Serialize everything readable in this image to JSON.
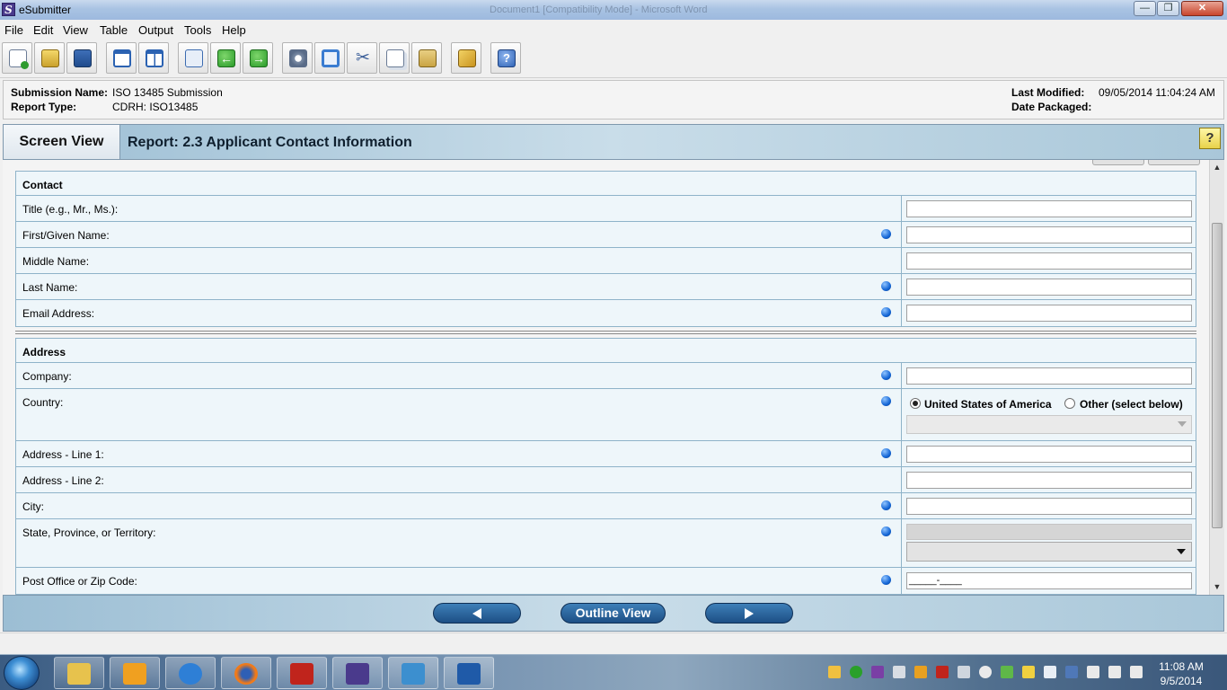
{
  "window": {
    "title": "eSubmitter",
    "background_title": "Document1 [Compatibility Mode] - Microsoft Word",
    "controls": {
      "minimize": "—",
      "maximize": "❐",
      "close": "✕"
    }
  },
  "menu": [
    "File",
    "Edit",
    "View",
    "Table",
    "Output",
    "Tools",
    "Help"
  ],
  "toolbar": {
    "icons": [
      "new-document-icon",
      "open-folder-icon",
      "save-icon",
      "single-window-icon",
      "split-window-icon",
      "home-icon",
      "back-arrow-icon",
      "forward-arrow-icon",
      "gear-settings-icon",
      "refresh-icon",
      "cut-icon",
      "copy-icon",
      "paste-icon",
      "package-icon",
      "help-icon"
    ],
    "back_glyph": "←",
    "forward_glyph": "→",
    "cut_glyph": "✂",
    "help_glyph": "?"
  },
  "info": {
    "submission_name_label": "Submission Name:",
    "submission_name": "ISO 13485 Submission",
    "report_type_label": "Report Type:",
    "report_type": "CDRH: ISO13485",
    "last_modified_label": "Last Modified:",
    "last_modified": "09/05/2014 11:04:24 AM",
    "date_packaged_label": "Date Packaged:",
    "date_packaged": ""
  },
  "screen": {
    "view_tab": "Screen View",
    "report_title": "Report: 2.3 Applicant Contact Information",
    "help_glyph": "?"
  },
  "contact": {
    "heading": "Contact",
    "rows": [
      {
        "label": "Title (e.g., Mr., Ms.):",
        "required": false,
        "value": ""
      },
      {
        "label": "First/Given Name:",
        "required": true,
        "value": ""
      },
      {
        "label": "Middle Name:",
        "required": false,
        "value": ""
      },
      {
        "label": "Last Name:",
        "required": true,
        "value": ""
      },
      {
        "label": "Email Address:",
        "required": true,
        "value": ""
      }
    ]
  },
  "address": {
    "heading": "Address",
    "company": {
      "label": "Company:",
      "required": true,
      "value": ""
    },
    "country": {
      "label": "Country:",
      "required": true,
      "option_usa": "United States of America",
      "option_other": "Other (select below)",
      "selected": "United States of America"
    },
    "line1": {
      "label": "Address - Line 1:",
      "required": true,
      "value": ""
    },
    "line2": {
      "label": "Address - Line 2:",
      "required": false,
      "value": ""
    },
    "city": {
      "label": "City:",
      "required": true,
      "value": ""
    },
    "state": {
      "label": "State, Province, or Territory:",
      "required": true
    },
    "zip": {
      "label": "Post Office or Zip Code:",
      "required": true,
      "mask": "_____-____"
    }
  },
  "nav": {
    "outline_view": "Outline View"
  },
  "taskbar": {
    "apps": [
      "windows-explorer-icon",
      "outlook-icon",
      "internet-explorer-icon",
      "firefox-icon",
      "adobe-reader-icon",
      "esubmitter-icon",
      "network-app-icon",
      "word-icon"
    ],
    "clock_time": "11:08 AM",
    "clock_date": "9/5/2014"
  }
}
